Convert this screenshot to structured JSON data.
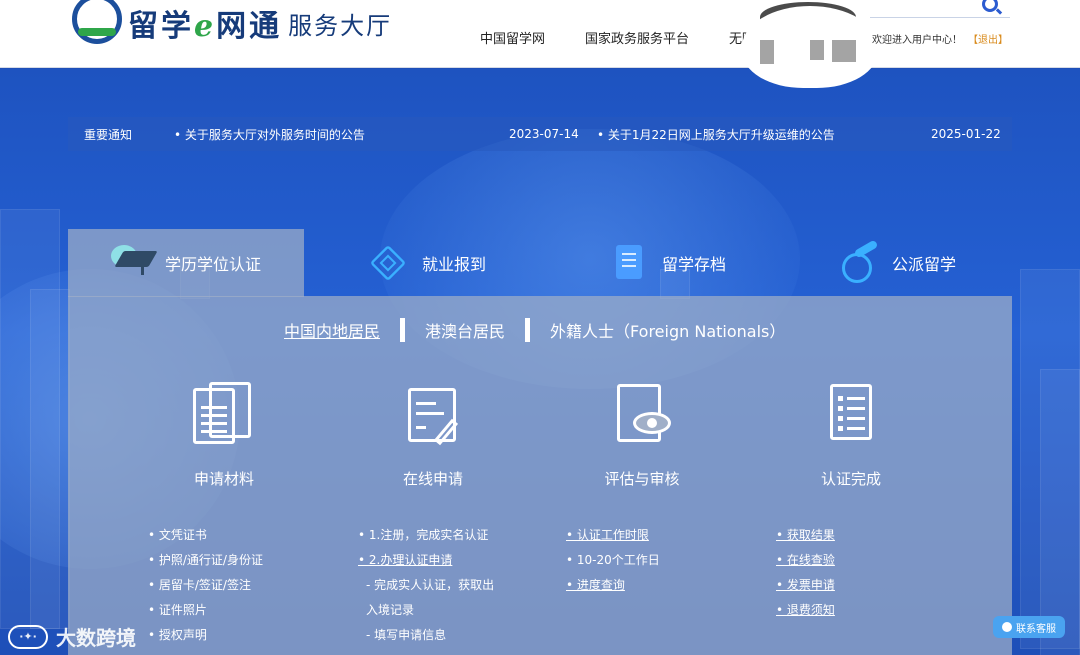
{
  "header": {
    "logo_text_a": "留学",
    "logo_text_e": "e",
    "logo_text_b": "网通",
    "logo_sub": "服务大厅",
    "nav": [
      "中国留学网",
      "国家政务服务平台",
      "无障碍"
    ],
    "welcome": "欢迎进入用户中心！",
    "logout": "【退出】"
  },
  "notice": {
    "label": "重要通知",
    "items": [
      {
        "title": "• 关于服务大厅对外服务时间的公告",
        "date": "2023-07-14"
      },
      {
        "title": "• 关于1月22日网上服务大厅升级运维的公告",
        "date": "2025-01-22"
      }
    ]
  },
  "tabs": [
    "学历学位认证",
    "就业报到",
    "留学存档",
    "公派留学"
  ],
  "subtabs": [
    "中国内地居民",
    "港澳台居民",
    "外籍人士（Foreign Nationals）"
  ],
  "steps": [
    "申请材料",
    "在线申请",
    "评估与审核",
    "认证完成"
  ],
  "columns": {
    "materials": [
      "• 文凭证书",
      "• 护照/通行证/身份证",
      "• 居留卡/签证/签注",
      "• 证件照片",
      "• 授权声明"
    ],
    "apply": [
      "• 1.注册，完成实名认证",
      "• 2.办理认证申请",
      "- 完成实人认证，获取出",
      "入境记录",
      "- 填写申请信息"
    ],
    "review": [
      "• 认证工作时限",
      "• 10-20个工作日",
      "• 进度查询"
    ],
    "done": [
      "• 获取结果",
      "• 在线查验",
      "• 发票申请",
      "• 退费须知"
    ]
  },
  "watermark": "大数跨境",
  "service": "联系客服"
}
